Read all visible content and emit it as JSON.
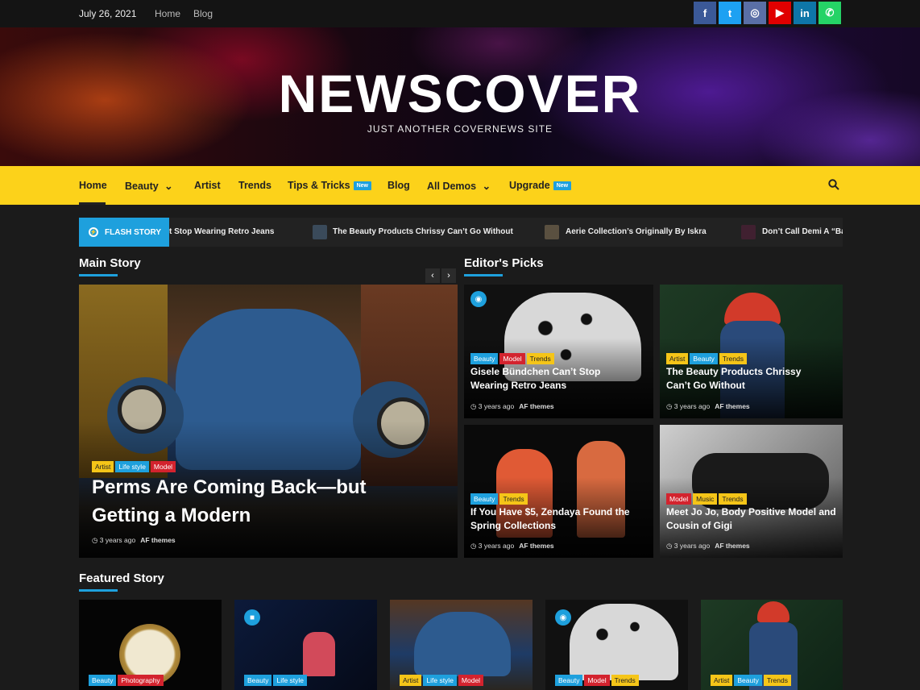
{
  "topbar": {
    "date": "July 26, 2021",
    "links": [
      "Home",
      "Blog"
    ]
  },
  "social": [
    {
      "icon": "facebook-icon",
      "glyph": "f",
      "color": "#3b5998"
    },
    {
      "icon": "twitter-icon",
      "glyph": "t",
      "color": "#1da1f2"
    },
    {
      "icon": "instagram-icon",
      "glyph": "◎",
      "color": "#5a6fa6"
    },
    {
      "icon": "youtube-icon",
      "glyph": "▶",
      "color": "#e00000"
    },
    {
      "icon": "linkedin-icon",
      "glyph": "in",
      "color": "#0e76a8"
    },
    {
      "icon": "whatsapp-icon",
      "glyph": "✆",
      "color": "#25d366"
    }
  ],
  "site": {
    "title": "NEWSCOVER",
    "description": "JUST ANOTHER COVERNEWS SITE"
  },
  "nav": {
    "items": [
      "Home",
      "Beauty",
      "Artist",
      "Trends",
      "Tips & Tricks",
      "Blog",
      "All Demos",
      "Upgrade"
    ],
    "new_badge": "New",
    "dropdown_glyph": "⌄",
    "search_icon": "search-icon"
  },
  "flash": {
    "label": "FLASH STORY",
    "items": [
      "t Stop Wearing Retro Jeans",
      "The Beauty Products Chrissy Can’t Go Without",
      "Aerie Collection’s Originally By Iskra",
      "Don’t Call Demi A “Ba"
    ]
  },
  "sections": {
    "main": "Main Story",
    "editors": "Editor's Picks",
    "featured": "Featured Story"
  },
  "main_story": {
    "categories": [
      "Artist",
      "Life style",
      "Model"
    ],
    "title": "Perms Are Coming Back—but Getting a Modern",
    "time": "3 years ago",
    "author": "AF themes"
  },
  "editors": [
    {
      "categories": [
        "Beauty",
        "Model",
        "Trends"
      ],
      "title": "Gisele Bündchen Can’t Stop Wearing Retro Jeans",
      "time": "3 years ago",
      "author": "AF themes"
    },
    {
      "categories": [
        "Artist",
        "Beauty",
        "Trends"
      ],
      "title": "The Beauty Products Chrissy Can’t Go Without",
      "time": "3 years ago",
      "author": "AF themes"
    },
    {
      "categories": [
        "Beauty",
        "Trends"
      ],
      "title": "If You Have $5, Zendaya Found the Spring Collections",
      "time": "3 years ago",
      "author": "AF themes"
    },
    {
      "categories": [
        "Model",
        "Music",
        "Trends"
      ],
      "title": "Meet Jo Jo, Body Positive Model and Cousin of Gigi",
      "time": "3 years ago",
      "author": "AF themes"
    }
  ],
  "featured": [
    {
      "categories": [
        "Beauty",
        "Photography"
      ]
    },
    {
      "categories": [
        "Beauty",
        "Life style"
      ]
    },
    {
      "categories": [
        "Artist",
        "Life style",
        "Model"
      ]
    },
    {
      "categories": [
        "Beauty",
        "Model",
        "Trends"
      ]
    },
    {
      "categories": [
        "Artist",
        "Beauty",
        "Trends"
      ]
    }
  ],
  "colors": {
    "accent": "#1ea0dd",
    "nav": "#fcd21a",
    "cat_red": "#d3232e",
    "cat_yellow": "#f5c518"
  }
}
